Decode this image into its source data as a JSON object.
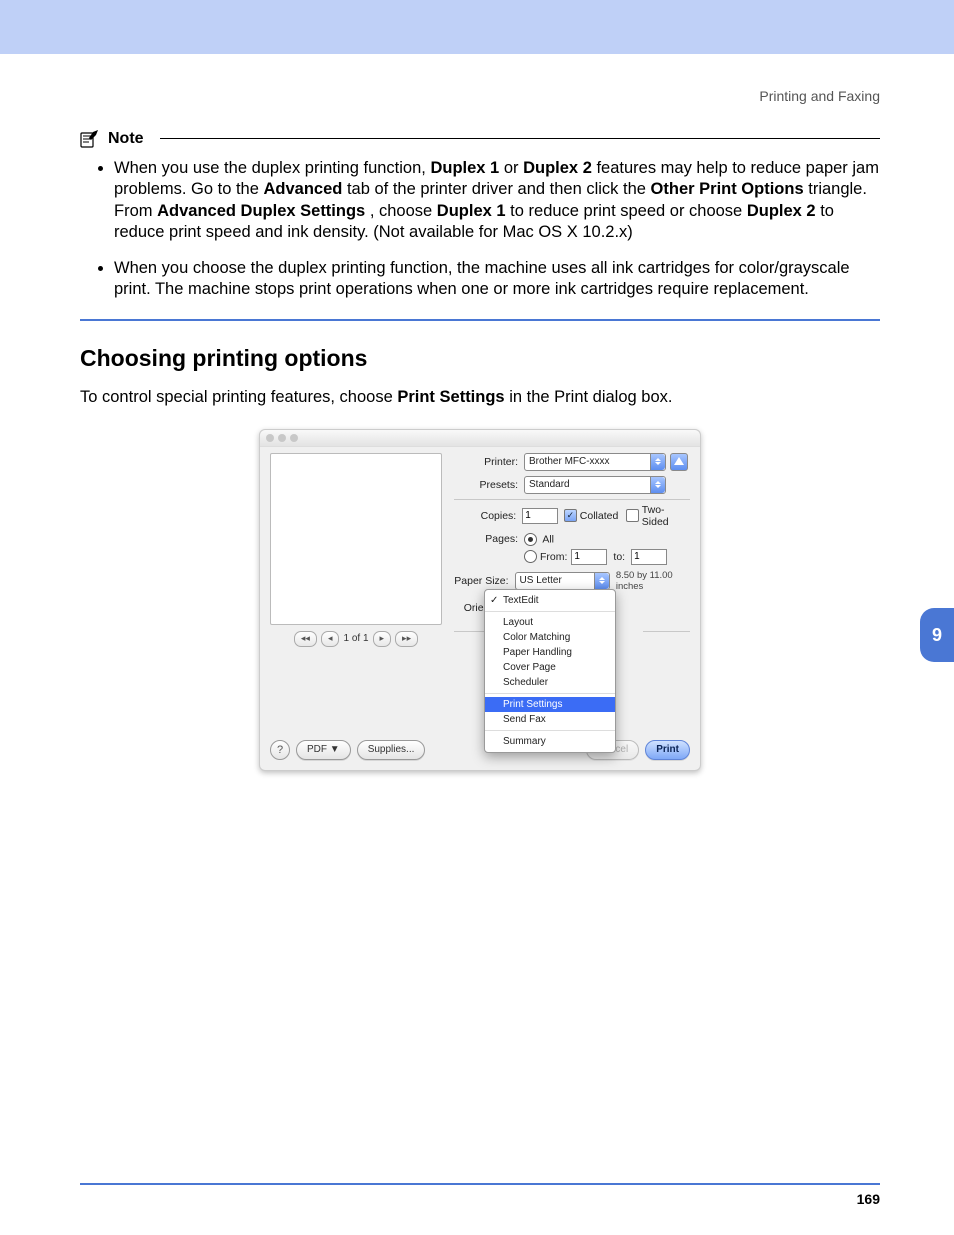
{
  "header": {
    "running": "Printing and Faxing"
  },
  "note": {
    "heading": "Note",
    "items": [
      {
        "parts": [
          "When you use the duplex printing function, ",
          "Duplex 1",
          " or ",
          "Duplex 2",
          " features may help to reduce paper jam problems. Go to the ",
          "Advanced",
          " tab of the printer driver and then click the ",
          "Other Print Options",
          " triangle. From ",
          "Advanced Duplex Settings",
          ", choose ",
          "Duplex 1",
          " to reduce print speed or choose ",
          "Duplex 2",
          " to reduce print speed and ink density. (Not available for Mac OS X 10.2.x)"
        ]
      },
      {
        "text": "When you choose the duplex printing function, the machine uses all ink cartridges for color/grayscale print. The machine stops print operations when one or more ink cartridges require replacement."
      }
    ]
  },
  "section": {
    "heading": "Choosing printing options",
    "intro": {
      "before": "To control special printing features, choose ",
      "bold": "Print Settings",
      "after": " in the Print dialog box."
    }
  },
  "dialog": {
    "labels": {
      "printer": "Printer:",
      "presets": "Presets:",
      "copies": "Copies:",
      "collated": "Collated",
      "twoSided": "Two-Sided",
      "pages": "Pages:",
      "all": "All",
      "from": "From:",
      "to": "to:",
      "paperSize": "Paper Size:",
      "orientation": "Orientation:"
    },
    "values": {
      "printer": "Brother MFC-xxxx",
      "presets": "Standard",
      "copies": "1",
      "pageFrom": "1",
      "pageTo": "1",
      "paperSize": "US Letter",
      "paperDims": "8.50 by 11.00 inches"
    },
    "preview": {
      "pager": "1 of 1"
    },
    "paneMenu": [
      "TextEdit",
      "Layout",
      "Color Matching",
      "Paper Handling",
      "Cover Page",
      "Scheduler",
      "Print Settings",
      "Send Fax",
      "Summary"
    ],
    "footer": {
      "pdf": "PDF",
      "supplies": "Supplies...",
      "cancel": "Cancel",
      "print": "Print"
    }
  },
  "page": {
    "chapter": "9",
    "number": "169"
  }
}
